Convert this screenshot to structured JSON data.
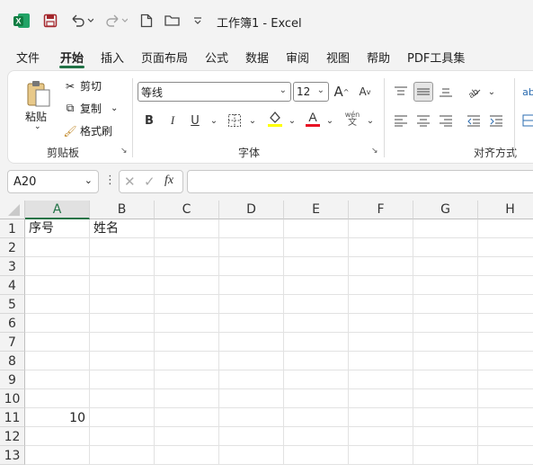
{
  "titlebar": {
    "title": "工作簿1  -  Excel",
    "app_icon": "excel-logo",
    "quick_access": [
      "save-icon",
      "undo-icon",
      "redo-icon",
      "new-file-icon",
      "open-folder-icon",
      "customize-icon"
    ]
  },
  "menu": {
    "items": [
      "文件",
      "开始",
      "插入",
      "页面布局",
      "公式",
      "数据",
      "审阅",
      "视图",
      "帮助",
      "PDF工具集"
    ],
    "active": "开始"
  },
  "ribbon": {
    "clipboard": {
      "paste": "粘贴",
      "cut": "剪切",
      "copy": "复制",
      "format_painter": "格式刷",
      "group_label": "剪贴板"
    },
    "font": {
      "font_name": "等线",
      "font_size": "12",
      "group_label": "字体",
      "bold": "B",
      "italic": "I",
      "underline": "U",
      "font_color_letter": "A",
      "grow": "A",
      "shrink": "A"
    },
    "alignment": {
      "group_label": "对齐方式"
    }
  },
  "formula_bar": {
    "name_box": "A20",
    "fx": "fx",
    "content": ""
  },
  "sheet": {
    "columns": [
      "A",
      "B",
      "C",
      "D",
      "E",
      "F",
      "G",
      "H"
    ],
    "selected_column": "A",
    "rows": [
      "1",
      "2",
      "3",
      "4",
      "5",
      "6",
      "7",
      "8",
      "9",
      "10",
      "11",
      "12",
      "13"
    ],
    "cells": {
      "A1": "序号",
      "B1": "姓名",
      "A11": "10"
    }
  },
  "colors": {
    "accent": "#217346",
    "font_color_bar": "#e81123",
    "highlight_bar": "#ffff00"
  }
}
